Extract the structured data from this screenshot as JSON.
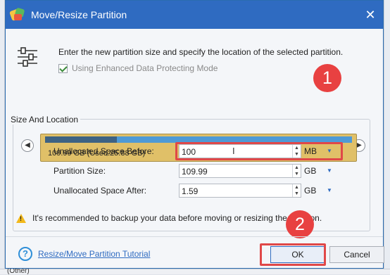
{
  "window": {
    "title": "Move/Resize Partition"
  },
  "header": {
    "intro_text": "Enter the new partition size and specify the location of the selected partition.",
    "checkbox_label": "Using Enhanced Data Protecting Mode",
    "checkbox_checked": true
  },
  "group": {
    "title": "Size And Location",
    "partition_label": "109.99 GB (Used:25.88 GB)",
    "used_fraction": 0.235
  },
  "fields": [
    {
      "label": "Unallocated Space Before:",
      "value": "100",
      "unit": "MB"
    },
    {
      "label": "Partition Size:",
      "value": "109.99",
      "unit": "GB"
    },
    {
      "label": "Unallocated Space After:",
      "value": "1.59",
      "unit": "GB"
    }
  ],
  "warning": "It's recommended to backup your data before moving or resizing the partition.",
  "footer": {
    "tutorial_link": "Resize/Move Partition Tutorial",
    "ok_label": "OK",
    "cancel_label": "Cancel"
  },
  "annotations": {
    "step1": "1",
    "step2": "2"
  },
  "background": {
    "bottom_text": "(Other)"
  },
  "colors": {
    "titlebar": "#2f6bc1",
    "highlight": "#e04848",
    "partition": "#e0c068",
    "bar": "#4e9ad6",
    "used": "#3d6283"
  }
}
